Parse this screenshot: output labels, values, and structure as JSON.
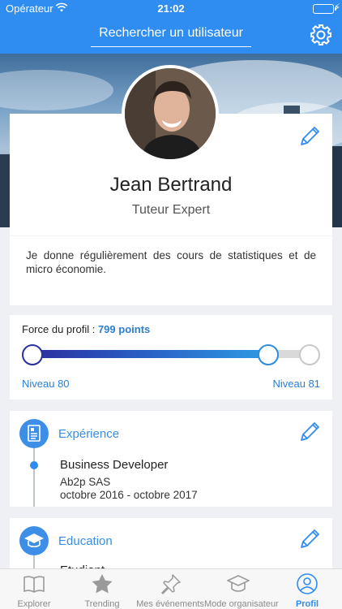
{
  "status_bar": {
    "carrier": "Opérateur",
    "time": "21:02"
  },
  "nav": {
    "search_label": "Rechercher un utilisateur"
  },
  "profile": {
    "name": "Jean Bertrand",
    "role": "Tuteur Expert",
    "bio": "Je donne régulièrement des cours de statistiques et de micro économie."
  },
  "strength": {
    "label": "Force du profil :",
    "points": "799 points",
    "level_current": "Niveau 80",
    "level_next": "Niveau 81",
    "progress_fraction": 0.85
  },
  "experience": {
    "title": "Expérience",
    "items": [
      {
        "position": "Business Developer",
        "company": "Ab2p SAS",
        "dates": "octobre 2016 - octobre 2017"
      }
    ]
  },
  "education": {
    "title": "Education",
    "peek": "Etudiant"
  },
  "tabs": [
    {
      "label": "Explorer",
      "icon": "book-icon"
    },
    {
      "label": "Trending",
      "icon": "star-icon"
    },
    {
      "label": "Mes événements",
      "icon": "pin-icon"
    },
    {
      "label": "Mode organisateur",
      "icon": "graduation-cap-icon"
    },
    {
      "label": "Profil",
      "icon": "user-icon",
      "active": true
    }
  ],
  "colors": {
    "accent": "#2f8cf0",
    "link": "#2a7fd4",
    "progress_start": "#2b2f9f",
    "progress_end": "#2f9be4"
  }
}
